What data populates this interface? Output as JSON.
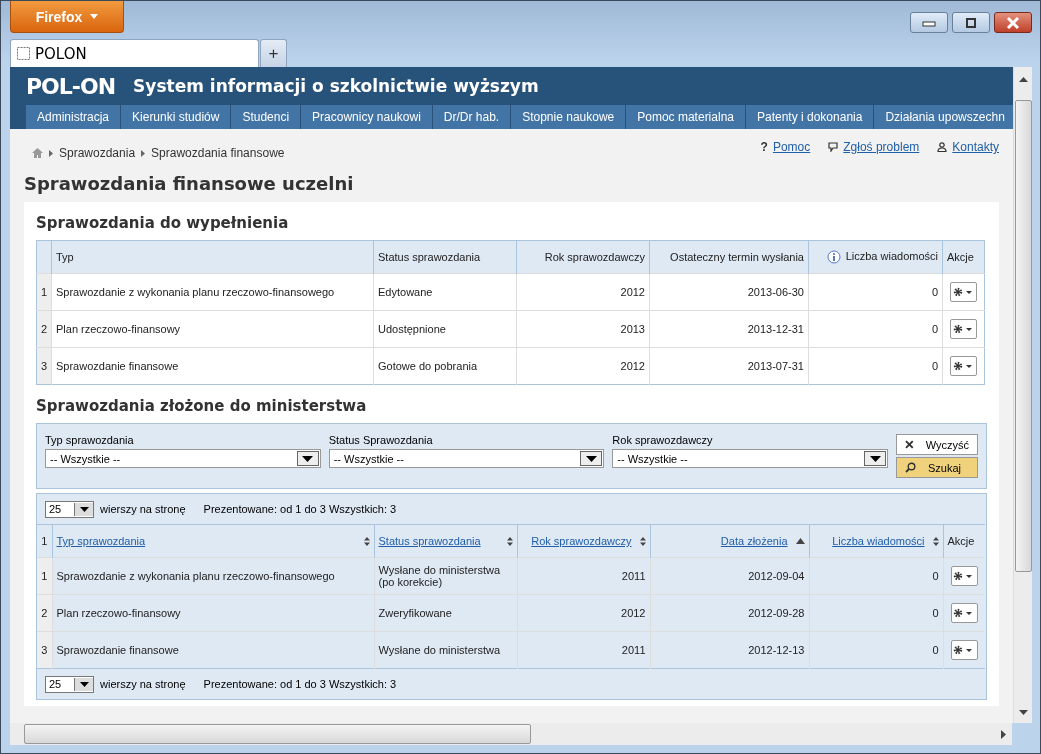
{
  "browser": {
    "menu_button": "Firefox",
    "tab": {
      "title": "POLON"
    },
    "new_tab": "+"
  },
  "header": {
    "logo": "POL-ON",
    "title": "System informacji o szkolnictwie wyższym"
  },
  "nav": [
    {
      "label": "Administracja",
      "selected": false
    },
    {
      "label": "Kierunki studiów",
      "selected": false
    },
    {
      "label": "Studenci",
      "selected": false
    },
    {
      "label": "Pracownicy naukowi",
      "selected": false
    },
    {
      "label": "Dr/Dr hab.",
      "selected": false
    },
    {
      "label": "Stopnie naukowe",
      "selected": false
    },
    {
      "label": "Pomoc materialna",
      "selected": false
    },
    {
      "label": "Patenty i dokonania",
      "selected": false
    },
    {
      "label": "Działania upowszechn",
      "selected": false
    }
  ],
  "breadcrumb": [
    "Sprawozdania",
    "Sprawozdania finansowe"
  ],
  "top_links": [
    {
      "kind": "help",
      "glyph": "?",
      "label": "Pomoc"
    },
    {
      "kind": "report",
      "label": "Zgłoś problem"
    },
    {
      "kind": "contacts",
      "label": "Kontakty"
    }
  ],
  "page_title": "Sprawozdania finansowe uczelni",
  "to_fill": {
    "title": "Sprawozdania do wypełnienia",
    "columns": [
      {
        "label": "Typ"
      },
      {
        "label": "Status sprawozdania"
      },
      {
        "label": "Rok sprawozdawczy"
      },
      {
        "label": "Ostateczny termin wysłania"
      },
      {
        "label": "Liczba wiadomości",
        "info": true
      },
      {
        "label": "Akcje"
      }
    ],
    "rows": [
      {
        "index": "1",
        "cells": [
          "Sprawozdanie z wykonania planu rzeczowo-finansowego",
          "Edytowane",
          "2012",
          "2013-06-30",
          "0"
        ]
      },
      {
        "index": "2",
        "cells": [
          "Plan rzeczowo-finansowy",
          "Udostępnione",
          "2013",
          "2013-12-31",
          "0"
        ]
      },
      {
        "index": "3",
        "cells": [
          "Sprawozdanie finansowe",
          "Gotowe do pobrania",
          "2012",
          "2013-07-31",
          "0"
        ]
      }
    ]
  },
  "submitted": {
    "title": "Sprawozdania złożone do ministerstwa",
    "filters": [
      {
        "label": "Typ sprawozdania",
        "value": "-- Wszystkie --"
      },
      {
        "label": "Status Sprawozdania",
        "value": "-- Wszystkie --"
      },
      {
        "label": "Rok sprawozdawczy",
        "value": "-- Wszystkie --"
      }
    ],
    "buttons": [
      {
        "kind": "clear",
        "label": "Wyczyść"
      },
      {
        "kind": "search",
        "label": "Szukaj"
      }
    ],
    "pager_top": {
      "page_size": "25",
      "per_page": "wierszy na stronę",
      "summary": "Prezentowane: od 1 do 3 Wszystkich: 3"
    },
    "index_header": "1",
    "columns": [
      {
        "label": "Typ sprawozdania",
        "link": true,
        "sortable": true,
        "sorted_ascending": false
      },
      {
        "label": "Status sprawozdania",
        "link": true,
        "sortable": true,
        "sorted_ascending": false
      },
      {
        "label": "Rok sprawozdawczy",
        "link": true,
        "sortable": true,
        "sorted_ascending": false
      },
      {
        "label": "Data złożenia",
        "link": true,
        "sortable": true,
        "sorted_ascending": true
      },
      {
        "label": "Liczba wiadomości",
        "link": true,
        "sortable": true,
        "sorted_ascending": false
      },
      {
        "label": "Akcje",
        "link": false
      }
    ],
    "rows": [
      {
        "index": "1",
        "cells": [
          "Sprawozdanie z wykonania planu rzeczowo-finansowego",
          "Wysłane do ministerstwa (po korekcie)",
          "2011",
          "2012-09-04",
          "0"
        ]
      },
      {
        "index": "2",
        "cells": [
          "Plan rzeczowo-finansowy",
          "Zweryfikowane",
          "2012",
          "2012-09-28",
          "0"
        ]
      },
      {
        "index": "3",
        "cells": [
          "Sprawozdanie finansowe",
          "Wysłane do ministerstwa",
          "2011",
          "2012-12-13",
          "0"
        ]
      }
    ],
    "pager_bottom": {
      "page_size": "25",
      "per_page": "wierszy na stronę",
      "summary": "Prezentowane: od 1 do 3 Wszystkich: 3"
    }
  }
}
